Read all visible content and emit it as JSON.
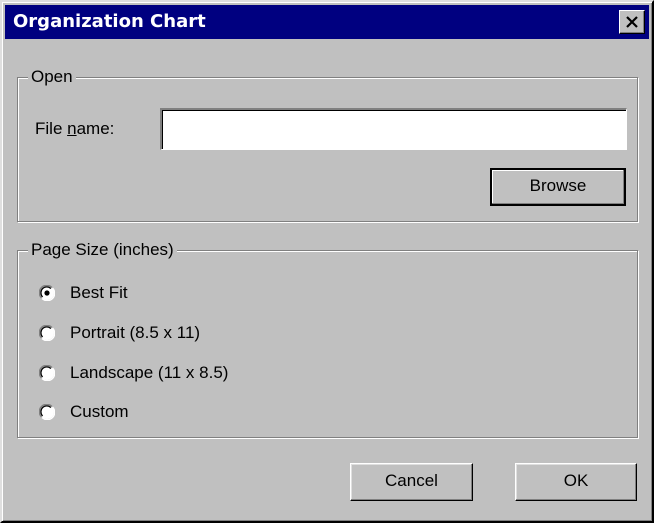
{
  "window": {
    "title": "Organization Chart",
    "colors": {
      "title_bar": "#000080",
      "face": "#c0c0c0"
    }
  },
  "title_bar": {
    "close_icon": "close-x-icon"
  },
  "open_group": {
    "legend": "Open",
    "file_name_label_prefix": "File ",
    "file_name_label_accel": "n",
    "file_name_label_suffix": "ame:",
    "file_name_value": "",
    "browse_label": "Browse"
  },
  "page_size_group": {
    "legend": "Page Size (inches)",
    "options": [
      {
        "label": "Best Fit",
        "selected": true
      },
      {
        "label": "Portrait (8.5 x 11)",
        "selected": false
      },
      {
        "label": "Landscape (11 x 8.5)",
        "selected": false
      },
      {
        "label": "Custom",
        "selected": false
      }
    ]
  },
  "footer": {
    "cancel_label": "Cancel",
    "ok_label": "OK"
  }
}
